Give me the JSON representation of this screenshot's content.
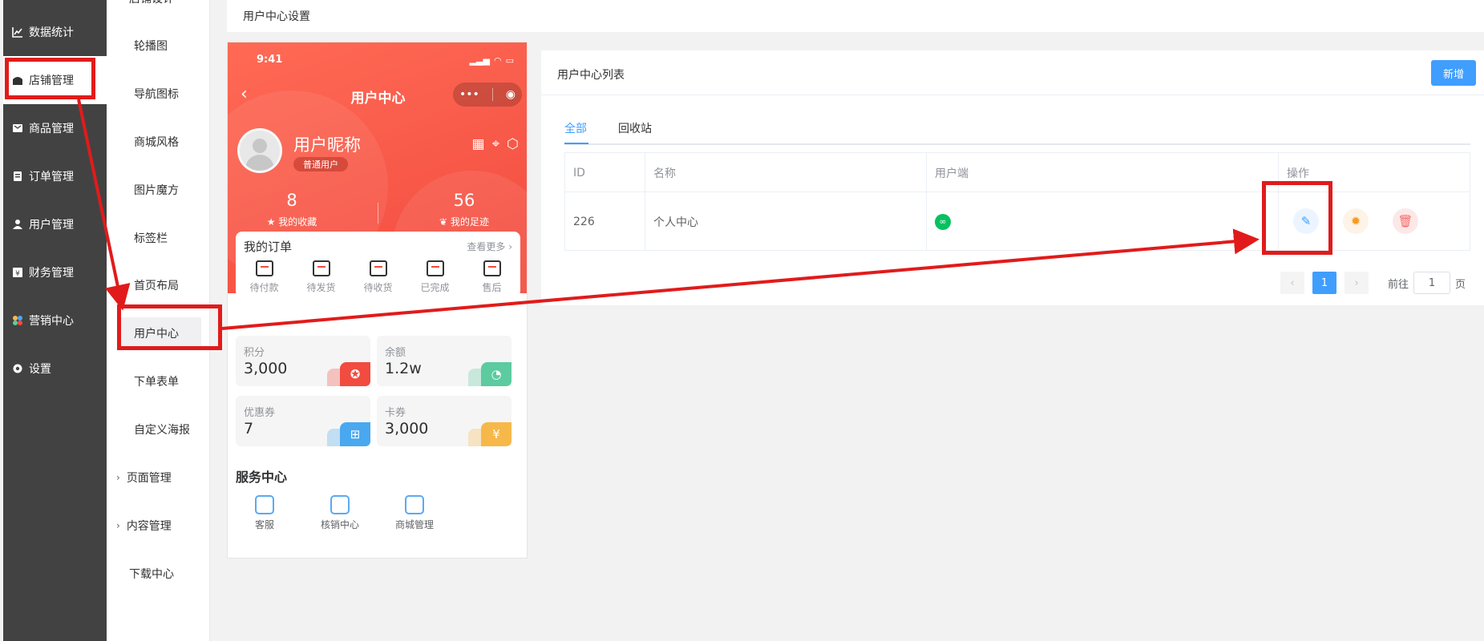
{
  "sidebar": {
    "items": [
      {
        "label": "数据统计",
        "icon": "chart-line-icon"
      },
      {
        "label": "店铺管理",
        "icon": "store-icon"
      },
      {
        "label": "商品管理",
        "icon": "goods-icon"
      },
      {
        "label": "订单管理",
        "icon": "order-icon"
      },
      {
        "label": "用户管理",
        "icon": "user-icon"
      },
      {
        "label": "财务管理",
        "icon": "finance-icon"
      },
      {
        "label": "营销中心",
        "icon": "marketing-icon"
      },
      {
        "label": "设置",
        "icon": "gear-icon"
      }
    ]
  },
  "subnav": {
    "top_cut": "店铺设计",
    "items": [
      "轮播图",
      "导航图标",
      "商城风格",
      "图片魔方",
      "标签栏",
      "首页布局",
      "用户中心",
      "下单表单",
      "自定义海报"
    ],
    "groups": [
      "页面管理",
      "内容管理"
    ],
    "download": "下载中心"
  },
  "header": {
    "title": "用户中心设置"
  },
  "phone": {
    "time": "9:41",
    "title": "用户中心",
    "nickname": "用户昵称",
    "level": "普通用户",
    "stats": [
      {
        "num": "8",
        "label": "我的收藏"
      },
      {
        "num": "56",
        "label": "我的足迹"
      }
    ],
    "orders": {
      "title": "我的订单",
      "more": "查看更多",
      "items": [
        "待付款",
        "待发货",
        "待收货",
        "已完成",
        "售后"
      ]
    },
    "assets": [
      {
        "label": "积分",
        "value": "3,000",
        "color": "#f24b3f"
      },
      {
        "label": "余额",
        "value": "1.2w",
        "color": "#5ccba0"
      },
      {
        "label": "优惠券",
        "value": "7",
        "color": "#4aa8f0"
      },
      {
        "label": "卡券",
        "value": "3,000",
        "color": "#f7b84a"
      }
    ],
    "service": {
      "title": "服务中心",
      "items": [
        "客服",
        "核销中心",
        "商城管理"
      ]
    }
  },
  "panel": {
    "title": "用户中心列表",
    "new_button": "新增",
    "tabs": [
      "全部",
      "回收站"
    ],
    "columns": [
      "ID",
      "名称",
      "用户端",
      "操作"
    ],
    "rows": [
      {
        "id": "226",
        "name": "个人中心"
      }
    ],
    "pager": {
      "current": "1",
      "goto_label": "前往",
      "goto_value": "1",
      "page_suffix": "页"
    }
  },
  "colors": {
    "primary": "#409eff",
    "annotation": "#e11b1b",
    "phone_red": "#f24b3f"
  }
}
